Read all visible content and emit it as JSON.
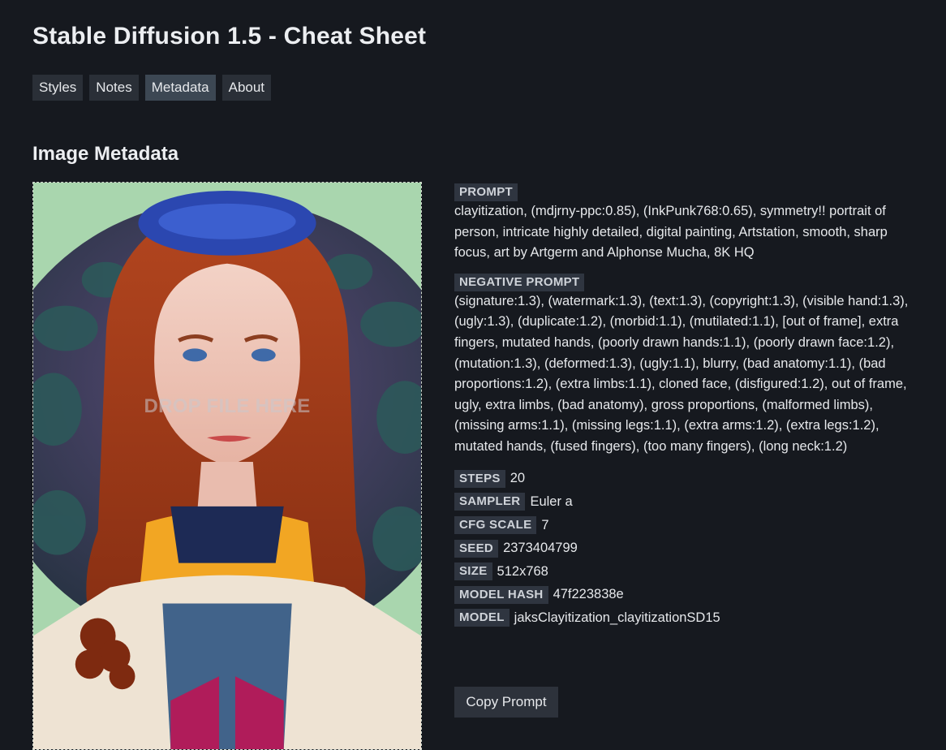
{
  "app": {
    "title": "Stable Diffusion 1.5 - Cheat Sheet"
  },
  "tabs": [
    {
      "label": "Styles",
      "active": false
    },
    {
      "label": "Notes",
      "active": false
    },
    {
      "label": "Metadata",
      "active": true
    },
    {
      "label": "About",
      "active": false
    }
  ],
  "section": {
    "title": "Image Metadata"
  },
  "dropzone": {
    "label": "DROP FILE HERE"
  },
  "metadata": {
    "prompt_label": "PROMPT",
    "prompt": "clayitization, (mdjrny-ppc:0.85), (InkPunk768:0.65), symmetry!! portrait of person, intricate highly detailed, digital painting, Artstation, smooth, sharp focus, art by Artgerm and Alphonse Mucha, 8K HQ",
    "negative_label": "NEGATIVE PROMPT",
    "negative": "(signature:1.3), (watermark:1.3), (text:1.3), (copyright:1.3), (visible hand:1.3), (ugly:1.3), (duplicate:1.2), (morbid:1.1), (mutilated:1.1), [out of frame], extra fingers, mutated hands, (poorly drawn hands:1.1), (poorly drawn face:1.2), (mutation:1.3), (deformed:1.3), (ugly:1.1), blurry, (bad anatomy:1.1), (bad proportions:1.2), (extra limbs:1.1), cloned face, (disfigured:1.2), out of frame, ugly, extra limbs, (bad anatomy), gross proportions, (malformed limbs), (missing arms:1.1), (missing legs:1.1), (extra arms:1.2), (extra legs:1.2), mutated hands, (fused fingers), (too many fingers), (long neck:1.2)",
    "steps_label": "STEPS",
    "steps": "20",
    "sampler_label": "SAMPLER",
    "sampler": "Euler a",
    "cfg_label": "CFG SCALE",
    "cfg": "7",
    "seed_label": "SEED",
    "seed": "2373404799",
    "size_label": "SIZE",
    "size": "512x768",
    "hash_label": "MODEL HASH",
    "hash": "47f223838e",
    "model_label": "MODEL",
    "model": "jaksClayitization_clayitizationSD15"
  },
  "actions": {
    "copy_label": "Copy Prompt"
  }
}
